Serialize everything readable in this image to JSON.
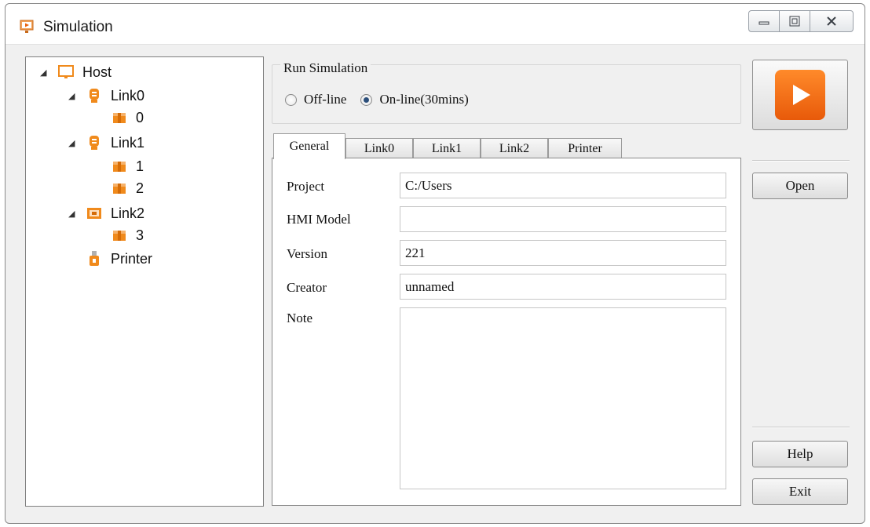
{
  "window": {
    "title": "Simulation"
  },
  "tree": [
    {
      "label": "Host",
      "icon": "monitor-icon",
      "expanded": true
    },
    {
      "label": "Link0",
      "icon": "link-port-icon",
      "expanded": true
    },
    {
      "label": "0",
      "icon": "device-box-icon"
    },
    {
      "label": "Link1",
      "icon": "link-port-icon",
      "expanded": true
    },
    {
      "label": "1",
      "icon": "device-box-icon"
    },
    {
      "label": "2",
      "icon": "device-box-icon"
    },
    {
      "label": "Link2",
      "icon": "ethernet-icon",
      "expanded": true
    },
    {
      "label": "3",
      "icon": "device-box-icon"
    },
    {
      "label": "Printer",
      "icon": "usb-printer-icon"
    }
  ],
  "run_simulation": {
    "title": "Run Simulation",
    "offline_label": "Off-line",
    "online_label": "On-line(30mins)",
    "selected": "online"
  },
  "tabs": [
    "General",
    "Link0",
    "Link1",
    "Link2",
    "Printer"
  ],
  "active_tab": "General",
  "general": {
    "project_label": "Project",
    "project_value": "C:/Users",
    "hmi_model_label": "HMI Model",
    "hmi_model_value": "",
    "version_label": "Version",
    "version_value": "221",
    "creator_label": "Creator",
    "creator_value": "unnamed",
    "note_label": "Note",
    "note_value": ""
  },
  "buttons": {
    "open": "Open",
    "help": "Help",
    "exit": "Exit"
  },
  "colors": {
    "accent": "#f07818",
    "icon_orange": "#f08a1c"
  }
}
